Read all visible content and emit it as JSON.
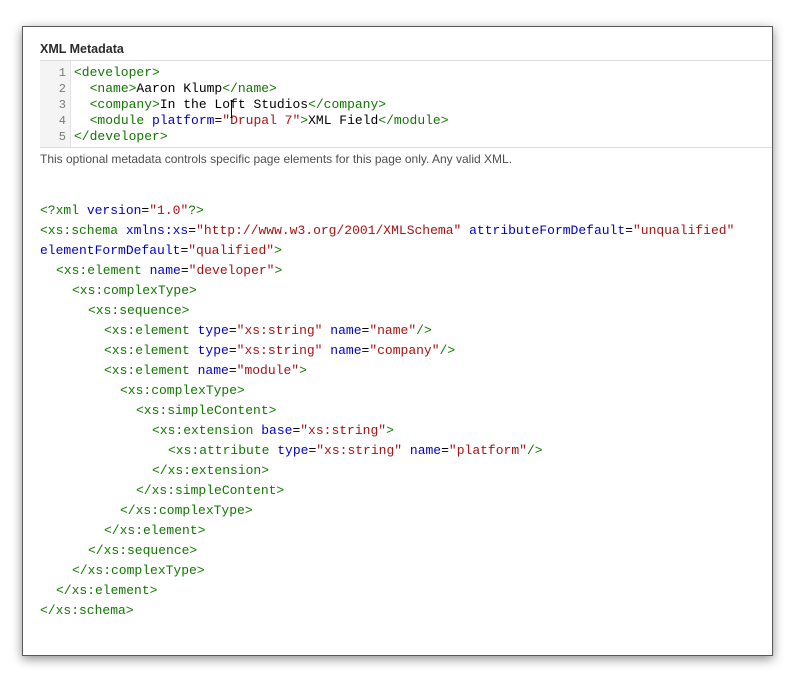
{
  "field": {
    "label": "XML Metadata",
    "description": "This optional metadata controls specific page elements for this page only. Any valid XML."
  },
  "editor": {
    "line_numbers": [
      "1",
      "2",
      "3",
      "4",
      "5"
    ],
    "lines": [
      {
        "indent": "",
        "tokens": [
          {
            "t": "tag",
            "v": "<developer>"
          }
        ]
      },
      {
        "indent": "  ",
        "tokens": [
          {
            "t": "tag",
            "v": "<name>"
          },
          {
            "t": "text",
            "v": "Aaron Klump"
          },
          {
            "t": "tag",
            "v": "</name>"
          }
        ]
      },
      {
        "indent": "  ",
        "tokens": [
          {
            "t": "tag",
            "v": "<company>"
          },
          {
            "t": "text",
            "v": "In the Loft Studios"
          },
          {
            "t": "tag",
            "v": "</company>"
          }
        ]
      },
      {
        "indent": "  ",
        "tokens": [
          {
            "t": "tag",
            "v": "<module "
          },
          {
            "t": "attr",
            "v": "platform"
          },
          {
            "t": "text",
            "v": "="
          },
          {
            "t": "str",
            "v": "\"Drupal 7\""
          },
          {
            "t": "tag",
            "v": ">"
          },
          {
            "t": "text",
            "v": "XML Field"
          },
          {
            "t": "tag",
            "v": "</module>"
          }
        ]
      },
      {
        "indent": "",
        "tokens": [
          {
            "t": "tag",
            "v": "</developer>"
          }
        ]
      }
    ]
  },
  "schema": {
    "lines": [
      {
        "depth": 0,
        "tokens": [
          {
            "t": "tag",
            "v": "<?xml "
          },
          {
            "t": "attr",
            "v": "version"
          },
          {
            "t": "text",
            "v": "="
          },
          {
            "t": "str",
            "v": "\"1.0\""
          },
          {
            "t": "tag",
            "v": "?>"
          }
        ]
      },
      {
        "depth": 0,
        "tokens": [
          {
            "t": "tag",
            "v": "<xs:schema "
          },
          {
            "t": "attr",
            "v": "xmlns:xs"
          },
          {
            "t": "text",
            "v": "="
          },
          {
            "t": "str",
            "v": "\"http://www.w3.org/2001/XMLSchema\""
          },
          {
            "t": "text",
            "v": " "
          },
          {
            "t": "attr",
            "v": "attributeFormDefault"
          },
          {
            "t": "text",
            "v": "="
          },
          {
            "t": "str",
            "v": "\"unqualified\""
          }
        ]
      },
      {
        "depth": 0,
        "tokens": [
          {
            "t": "attr",
            "v": "elementFormDefault"
          },
          {
            "t": "text",
            "v": "="
          },
          {
            "t": "str",
            "v": "\"qualified\""
          },
          {
            "t": "tag",
            "v": ">"
          }
        ]
      },
      {
        "depth": 1,
        "tokens": [
          {
            "t": "tag",
            "v": "<xs:element "
          },
          {
            "t": "attr",
            "v": "name"
          },
          {
            "t": "text",
            "v": "="
          },
          {
            "t": "str",
            "v": "\"developer\""
          },
          {
            "t": "tag",
            "v": ">"
          }
        ]
      },
      {
        "depth": 2,
        "tokens": [
          {
            "t": "tag",
            "v": "<xs:complexType>"
          }
        ]
      },
      {
        "depth": 3,
        "tokens": [
          {
            "t": "tag",
            "v": "<xs:sequence>"
          }
        ]
      },
      {
        "depth": 4,
        "tokens": [
          {
            "t": "tag",
            "v": "<xs:element "
          },
          {
            "t": "attr",
            "v": "type"
          },
          {
            "t": "text",
            "v": "="
          },
          {
            "t": "str",
            "v": "\"xs:string\""
          },
          {
            "t": "text",
            "v": " "
          },
          {
            "t": "attr",
            "v": "name"
          },
          {
            "t": "text",
            "v": "="
          },
          {
            "t": "str",
            "v": "\"name\""
          },
          {
            "t": "tag",
            "v": "/>"
          }
        ]
      },
      {
        "depth": 4,
        "tokens": [
          {
            "t": "tag",
            "v": "<xs:element "
          },
          {
            "t": "attr",
            "v": "type"
          },
          {
            "t": "text",
            "v": "="
          },
          {
            "t": "str",
            "v": "\"xs:string\""
          },
          {
            "t": "text",
            "v": " "
          },
          {
            "t": "attr",
            "v": "name"
          },
          {
            "t": "text",
            "v": "="
          },
          {
            "t": "str",
            "v": "\"company\""
          },
          {
            "t": "tag",
            "v": "/>"
          }
        ]
      },
      {
        "depth": 4,
        "tokens": [
          {
            "t": "tag",
            "v": "<xs:element "
          },
          {
            "t": "attr",
            "v": "name"
          },
          {
            "t": "text",
            "v": "="
          },
          {
            "t": "str",
            "v": "\"module\""
          },
          {
            "t": "tag",
            "v": ">"
          }
        ]
      },
      {
        "depth": 5,
        "tokens": [
          {
            "t": "tag",
            "v": "<xs:complexType>"
          }
        ]
      },
      {
        "depth": 6,
        "tokens": [
          {
            "t": "tag",
            "v": "<xs:simpleContent>"
          }
        ]
      },
      {
        "depth": 7,
        "tokens": [
          {
            "t": "tag",
            "v": "<xs:extension "
          },
          {
            "t": "attr",
            "v": "base"
          },
          {
            "t": "text",
            "v": "="
          },
          {
            "t": "str",
            "v": "\"xs:string\""
          },
          {
            "t": "tag",
            "v": ">"
          }
        ]
      },
      {
        "depth": 8,
        "tokens": [
          {
            "t": "tag",
            "v": "<xs:attribute "
          },
          {
            "t": "attr",
            "v": "type"
          },
          {
            "t": "text",
            "v": "="
          },
          {
            "t": "str",
            "v": "\"xs:string\""
          },
          {
            "t": "text",
            "v": " "
          },
          {
            "t": "attr",
            "v": "name"
          },
          {
            "t": "text",
            "v": "="
          },
          {
            "t": "str",
            "v": "\"platform\""
          },
          {
            "t": "tag",
            "v": "/>"
          }
        ]
      },
      {
        "depth": 7,
        "tokens": [
          {
            "t": "tag",
            "v": "</xs:extension>"
          }
        ]
      },
      {
        "depth": 6,
        "tokens": [
          {
            "t": "tag",
            "v": "</xs:simpleContent>"
          }
        ]
      },
      {
        "depth": 5,
        "tokens": [
          {
            "t": "tag",
            "v": "</xs:complexType>"
          }
        ]
      },
      {
        "depth": 4,
        "tokens": [
          {
            "t": "tag",
            "v": "</xs:element>"
          }
        ]
      },
      {
        "depth": 3,
        "tokens": [
          {
            "t": "tag",
            "v": "</xs:sequence>"
          }
        ]
      },
      {
        "depth": 2,
        "tokens": [
          {
            "t": "tag",
            "v": "</xs:complexType>"
          }
        ]
      },
      {
        "depth": 1,
        "tokens": [
          {
            "t": "tag",
            "v": "</xs:element>"
          }
        ]
      },
      {
        "depth": 0,
        "tokens": [
          {
            "t": "tag",
            "v": "</xs:schema>"
          }
        ]
      }
    ]
  },
  "colors": {
    "tag": "#117700",
    "attribute": "#0000cc",
    "string": "#aa1111",
    "text": "#000000"
  },
  "icons": {
    "cursor": "text-cursor-icon"
  }
}
